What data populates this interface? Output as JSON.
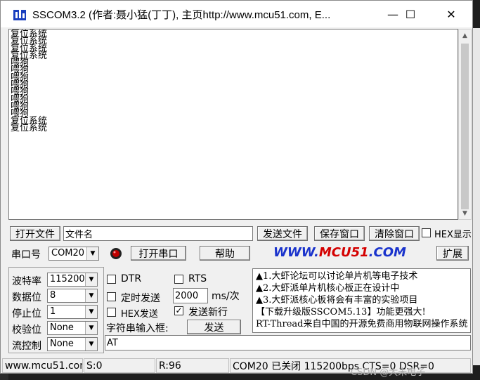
{
  "window": {
    "title": "SSCOM3.2 (作者:聂小猛(丁丁), 主页http://www.mcu51.com,  E...",
    "minimize": "—",
    "maximize": "☐",
    "close": "✕"
  },
  "receive": {
    "lines": [
      "复位系统",
      "复位系统",
      "复位系统",
      "复位系统",
      "喂狗",
      "喂狗",
      "喂狗",
      "喂狗",
      "喂狗",
      "喂狗",
      "喂狗",
      "喂狗",
      "复位系统",
      "复位系统"
    ]
  },
  "row1": {
    "open_file": "打开文件",
    "file_name": "文件名",
    "send_file": "发送文件",
    "save_window": "保存窗口",
    "clear_window": "清除窗口",
    "hex_display": "HEX显示"
  },
  "row2": {
    "port_label": "串口号",
    "port_value": "COM20",
    "open_port": "打开串口",
    "help": "帮助",
    "brand_a": "WWW.",
    "brand_b": "MCU51",
    "brand_c": ".COM",
    "expand": "扩展"
  },
  "settings": {
    "baud_label": "波特率",
    "baud_value": "115200",
    "data_label": "数据位",
    "data_value": "8",
    "stop_label": "停止位",
    "stop_value": "1",
    "parity_label": "校验位",
    "parity_value": "None",
    "flow_label": "流控制",
    "flow_value": "None"
  },
  "options": {
    "dtr": "DTR",
    "rts": "RTS",
    "timed_send": "定时发送",
    "interval_value": "2000",
    "interval_unit": "ms/次",
    "hex_send": "HEX发送",
    "send_newline": "发送新行",
    "input_label": "字符串输入框:",
    "send": "发送",
    "input_value": "AT"
  },
  "news": [
    "▲1.大虾论坛可以讨论单片机等电子技术",
    "▲2.大虾派单片机核心板正在设计中",
    "▲3.大虾派核心板将会有丰富的实验项目",
    "【下载升级版SSCOM5.13】功能更强大!",
    "RT-Thread来自中国的开源免费商用物联网操作系统"
  ],
  "status": {
    "site": "www.mcu51.com",
    "sent": "S:0",
    "received": "R:96",
    "port_state": "COM20 已关闭  115200bps CTS=0 DSR=0",
    "watermark": "CSDN @大米电子"
  }
}
